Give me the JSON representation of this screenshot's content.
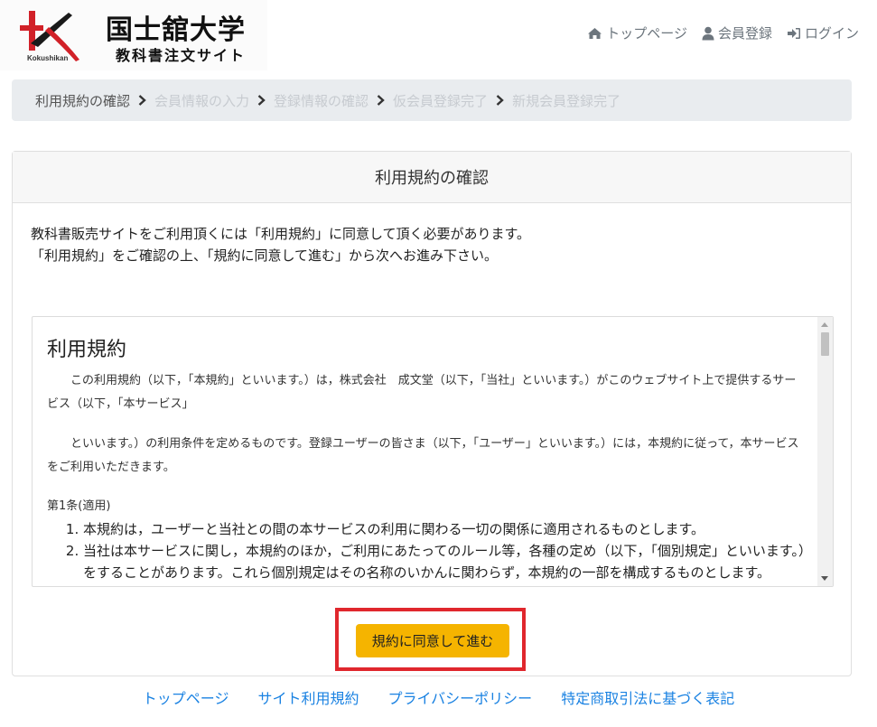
{
  "brand": {
    "name": "国士舘大学",
    "subtitle": "教科書注文サイト",
    "roman": "Kokushikan",
    "colors": {
      "mark_red": "#d12128",
      "mark_black": "#1a1a1a"
    }
  },
  "topnav": {
    "items": [
      {
        "label": "トップページ",
        "icon": "home-icon"
      },
      {
        "label": "会員登録",
        "icon": "user-icon"
      },
      {
        "label": "ログイン",
        "icon": "sign-in-icon"
      }
    ]
  },
  "breadcrumb": {
    "steps": [
      {
        "label": "利用規約の確認",
        "active": true
      },
      {
        "label": "会員情報の入力",
        "active": false
      },
      {
        "label": "登録情報の確認",
        "active": false
      },
      {
        "label": "仮会員登録完了",
        "active": false
      },
      {
        "label": "新規会員登録完了",
        "active": false
      }
    ]
  },
  "card": {
    "title": "利用規約の確認",
    "intro_line1": "教科書販売サイトをご利用頂くには「利用規約」に同意して頂く必要があります。",
    "intro_line2": "「利用規約」をご確認の上、「規約に同意して進む」から次へお進み下さい。"
  },
  "terms": {
    "title": "利用規約",
    "paragraph1": "この利用規約（以下，「本規約」といいます。）は，株式会社　成文堂（以下，「当社」といいます。）がこのウェブサイト上で提供するサービス（以下，「本サービス」",
    "paragraph2": "といいます。）の利用条件を定めるものです。登録ユーザーの皆さま（以下，「ユーザー」といいます。）には，本規約に従って，本サービスをご利用いただきます。",
    "article1_title": "第1条(適用)",
    "article1_items": [
      "本規約は，ユーザーと当社との間の本サービスの利用に関わる一切の関係に適用されるものとします。",
      "当社は本サービスに関し，本規約のほか，ご利用にあたってのルール等，各種の定め（以下，「個別規定」といいます。）をすることがあります。これら個別規定はその名称のいかんに関わらず，本規約の一部を構成するものとします。"
    ]
  },
  "agree_button": {
    "label": "規約に同意して進む",
    "color": "#f5b400",
    "highlight_color": "#e0272d"
  },
  "footer": {
    "links": [
      "トップページ",
      "サイト利用規約",
      "プライバシーポリシー",
      "特定商取引法に基づく表記"
    ],
    "link_color": "#1a82e2"
  }
}
